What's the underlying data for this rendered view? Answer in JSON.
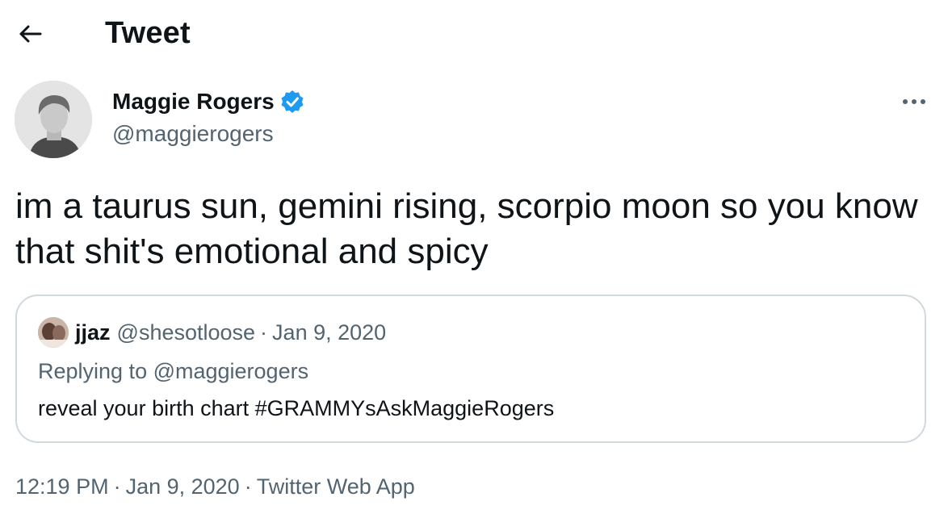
{
  "header": {
    "title": "Tweet",
    "back_icon": "arrow-left-icon"
  },
  "author": {
    "name": "Maggie Rogers",
    "handle": "@maggierogers",
    "verified": true,
    "verified_color": "#1d9bf0"
  },
  "tweet": {
    "text": "im a taurus sun, gemini rising, scorpio moon so you know that shit's emotional and spicy"
  },
  "quoted": {
    "name": "jjaz",
    "handle": "@shesotloose",
    "separator": "·",
    "date": "Jan 9, 2020",
    "replying_to": "Replying to @maggierogers",
    "text": "reveal your birth chart #GRAMMYsAskMaggieRogers"
  },
  "meta": {
    "time": "12:19 PM",
    "separator": "·",
    "date": "Jan 9, 2020",
    "source": "Twitter Web App"
  },
  "colors": {
    "text_primary": "#0f1419",
    "text_secondary": "#536471",
    "border": "#cfd9de",
    "accent": "#1d9bf0"
  },
  "icons": {
    "more": "more-horizontal-icon",
    "verified": "verified-badge-icon"
  }
}
